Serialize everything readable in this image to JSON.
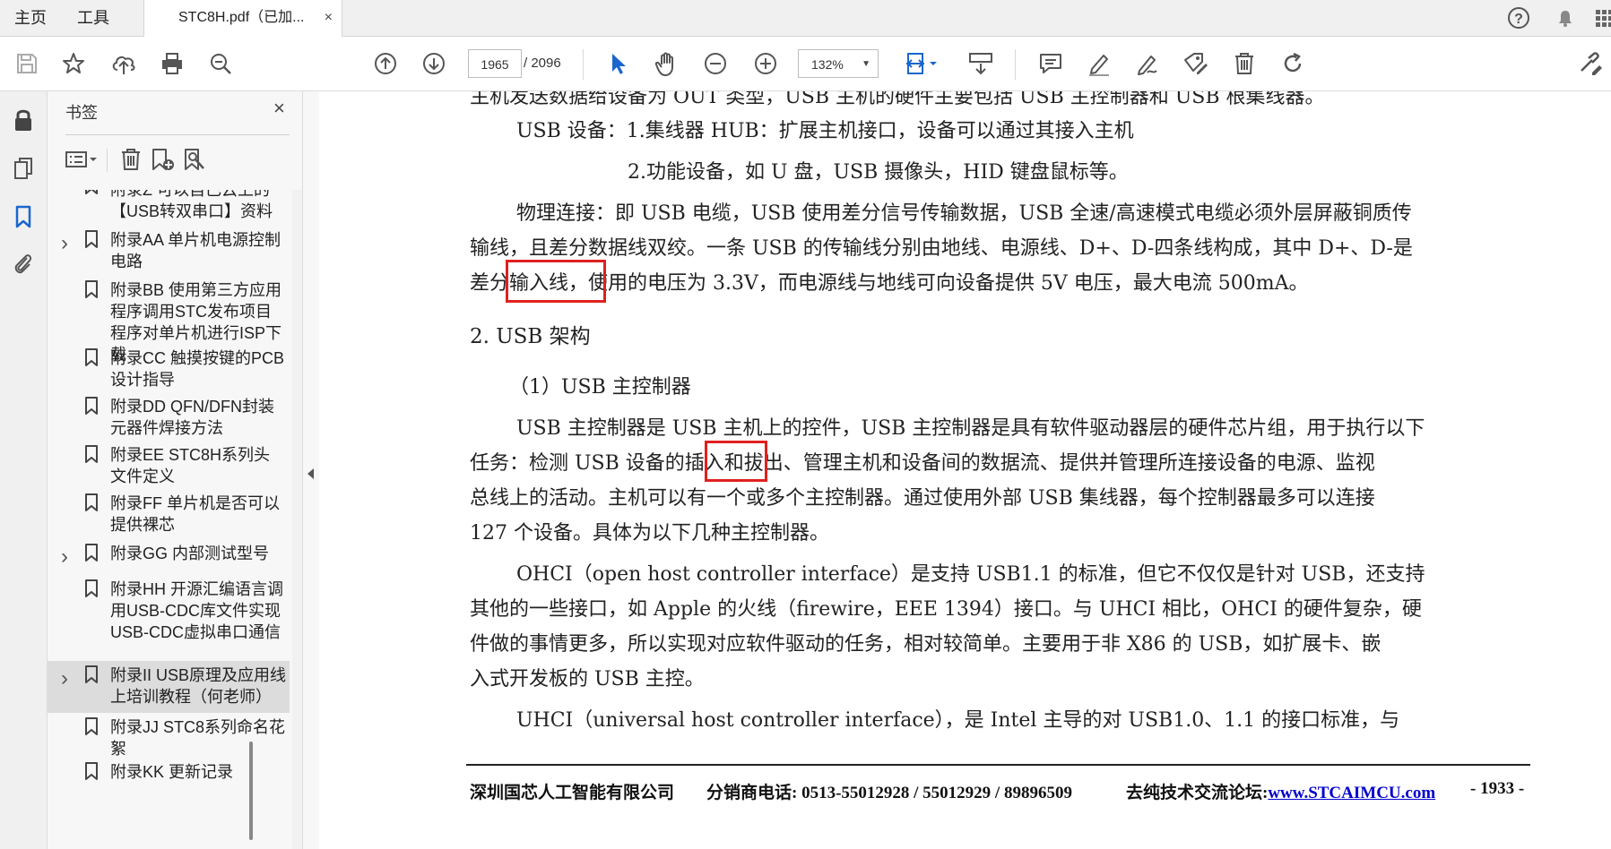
{
  "topbar": {
    "nav": [
      "主页",
      "工具"
    ],
    "tab_title": "STC8H.pdf（已加...",
    "tab_close": "×",
    "help": "?"
  },
  "toolbar": {
    "page_current": "1965",
    "page_total": "/ 2096",
    "zoom": "132%"
  },
  "bookmarks": {
    "title": "书签",
    "close": "×",
    "items": [
      {
        "text": "附录Z 可以自己云上的【USB转双串口】资料",
        "expandable": false,
        "selected": false
      },
      {
        "text": "附录AA 单片机电源控制电路",
        "expandable": true,
        "selected": false
      },
      {
        "text": "附录BB 使用第三方应用程序调用STC发布项目程序对单片机进行ISP下载",
        "expandable": false,
        "selected": false
      },
      {
        "text": "附录CC 触摸按键的PCB设计指导",
        "expandable": false,
        "selected": false
      },
      {
        "text": "附录DD QFN/DFN封装元器件焊接方法",
        "expandable": false,
        "selected": false
      },
      {
        "text": "附录EE STC8H系列头文件定义",
        "expandable": false,
        "selected": false
      },
      {
        "text": "附录FF 单片机是否可以提供裸芯",
        "expandable": false,
        "selected": false
      },
      {
        "text": "附录GG 内部测试型号",
        "expandable": true,
        "selected": false
      },
      {
        "text": "附录HH 开源汇编语言调用USB-CDC库文件实现USB-CDC虚拟串口通信",
        "expandable": false,
        "selected": false
      },
      {
        "text": "附录II USB原理及应用线上培训教程（何老师）",
        "expandable": true,
        "selected": true
      },
      {
        "text": "附录JJ STC8系列命名花絮",
        "expandable": false,
        "selected": false
      },
      {
        "text": "附录KK 更新记录",
        "expandable": false,
        "selected": false
      }
    ]
  },
  "document": {
    "line0": "主机发送数据给设备为 OUT 类型，USB 主机的硬件主要包括 USB 主控制器和 USB 根集线器。",
    "line1": "USB 设备：1.集线器 HUB：扩展主机接口，设备可以通过其接入主机",
    "line2": "2.功能设备，如 U 盘，USB 摄像头，HID 键盘鼠标等。",
    "line3": "物理连接：即 USB 电缆，USB 使用差分信号传输数据，USB 全速/高速模式电缆必须外层屏蔽铜质传",
    "line4": "输线，且差分数据线双绞。一条 USB 的传输线分别由地线、电源线、D+、D-四条线构成，其中 D+、D-是",
    "line5": "差分输入线，使用的电压为 3.3V，而电源线与地线可向设备提供 5V 电压，最大电流 500mA。",
    "heading": "2. USB 架构",
    "subheading": "（1）USB 主控制器",
    "line6": "USB 主控制器是 USB 主机上的控件，USB 主控制器是具有软件驱动器层的硬件芯片组，用于执行以下",
    "line7": "任务：检测 USB 设备的插入和拔出、管理主机和设备间的数据流、提供并管理所连接设备的电源、监视",
    "line8": "总线上的活动。主机可以有一个或多个主控制器。通过使用外部 USB 集线器，每个控制器最多可以连接",
    "line9": "127 个设备。具体为以下几种主控制器。",
    "line10": "OHCI（open host controller interface）是支持 USB1.1 的标准，但它不仅仅是针对 USB，还支持",
    "line11": "其他的一些接口，如 Apple 的火线（firewire，EEE 1394）接口。与 UHCI 相比，OHCI 的硬件复杂，硬",
    "line12": "件做的事情更多，所以实现对应软件驱动的任务，相对较简单。主要用于非 X86 的 USB，如扩展卡、嵌",
    "line13": "入式开发板的 USB 主控。",
    "line14": "UHCI（universal host controller interface），是 Intel 主导的对 USB1.0、1.1 的接口标准，与"
  },
  "footer": {
    "company": "深圳国芯人工智能有限公司",
    "phone": "分销商电话: 0513-55012928 / 55012929 / 89896509",
    "forum_label": "去纯技术交流论坛:",
    "forum_url": "www.STCAIMCU.com",
    "page": "- 1933 -"
  },
  "colors": {
    "highlight": "#e02020",
    "accent": "#1a66cc"
  }
}
